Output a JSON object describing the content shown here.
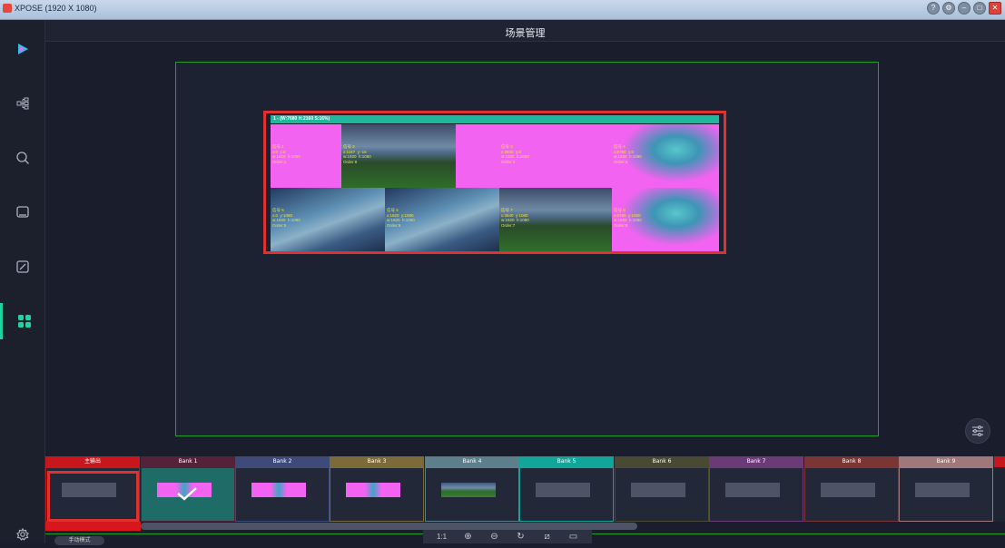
{
  "window": {
    "title": "XPOSE (1920 X 1080)",
    "buttons": [
      "help-icon",
      "settings-icon",
      "minimize-icon",
      "maximize-icon",
      "close-icon"
    ]
  },
  "header": {
    "title": "场景管理"
  },
  "sidebar": {
    "items": [
      {
        "icon": "logo-play-icon",
        "active": false
      },
      {
        "icon": "topology-icon",
        "active": false
      },
      {
        "icon": "search-icon",
        "active": false
      },
      {
        "icon": "screen-icon",
        "active": false
      },
      {
        "icon": "edit-icon",
        "active": false
      },
      {
        "icon": "grid-icon",
        "active": true
      }
    ],
    "bottom_icon": "settings-gear-icon"
  },
  "layer": {
    "label": "1 - (W:7680 H:2160 S:16%)",
    "tiles": [
      {
        "text": "信号 1\nx:0  y:0\nw:1920  h:1080\nOrder:1",
        "style": "pink"
      },
      {
        "text": "信号 2\nx:1167  y:-16\nw:1920  h:1080\nOrder:8",
        "style": "land"
      },
      {
        "text": "信号 3\nx:3840  y:0\nw:1920  h:1080\nOrder:3",
        "style": "pink"
      },
      {
        "text": "信号 4\nx:5760  y:0\nw:1920  h:1080\nOrder:4",
        "style": "splash"
      },
      {
        "text": "信号 5\nx:0  y:1080\nw:1920  h:1080\nOrder:5",
        "style": "sky"
      },
      {
        "text": "信号 6\nx:1920  y:1080\nw:1920  h:1080\nOrder:6",
        "style": "sky"
      },
      {
        "text": "信号 7\nx:3840  y:1080\nw:1920  h:1080\nOrder:7",
        "style": "land"
      },
      {
        "text": "信号 8\nx:5760  y:1080\nw:1920  h:1080\nOrder:8",
        "style": "splash"
      }
    ]
  },
  "banks": [
    {
      "label": "主输出",
      "head": "#c8161d",
      "border": "#c8161d",
      "thumb": "plain"
    },
    {
      "label": "Bank 1",
      "head": "#56223a",
      "border": "#56223a",
      "thumb": "pinky",
      "selected": true
    },
    {
      "label": "Bank 2",
      "head": "#3d4a7a",
      "border": "#3d4a7a",
      "thumb": "pinky"
    },
    {
      "label": "Bank 3",
      "head": "#7d6a3b",
      "border": "#7d6a3b",
      "thumb": "pinky"
    },
    {
      "label": "Bank 4",
      "head": "#5d7f8c",
      "border": "#5d7f8c",
      "thumb": "grassy"
    },
    {
      "label": "Bank 5",
      "head": "#12a59a",
      "border": "#12a59a",
      "thumb": "plain"
    },
    {
      "label": "Bank 6",
      "head": "#4a4934",
      "border": "#4a4934",
      "thumb": "plain"
    },
    {
      "label": "Bank 7",
      "head": "#6d3a78",
      "border": "#6d3a78",
      "thumb": "plain"
    },
    {
      "label": "Bank 8",
      "head": "#7a3534",
      "border": "#7a3534",
      "thumb": "plain"
    },
    {
      "label": "Bank 9",
      "head": "#a0777a",
      "border": "#a0777a",
      "thumb": "plain"
    }
  ],
  "footer": {
    "mode_label": "手动模式",
    "zoom_tools": [
      "1:1",
      "zoom-in-icon",
      "zoom-out-icon",
      "refresh-icon",
      "clear-icon",
      "save-icon"
    ]
  }
}
